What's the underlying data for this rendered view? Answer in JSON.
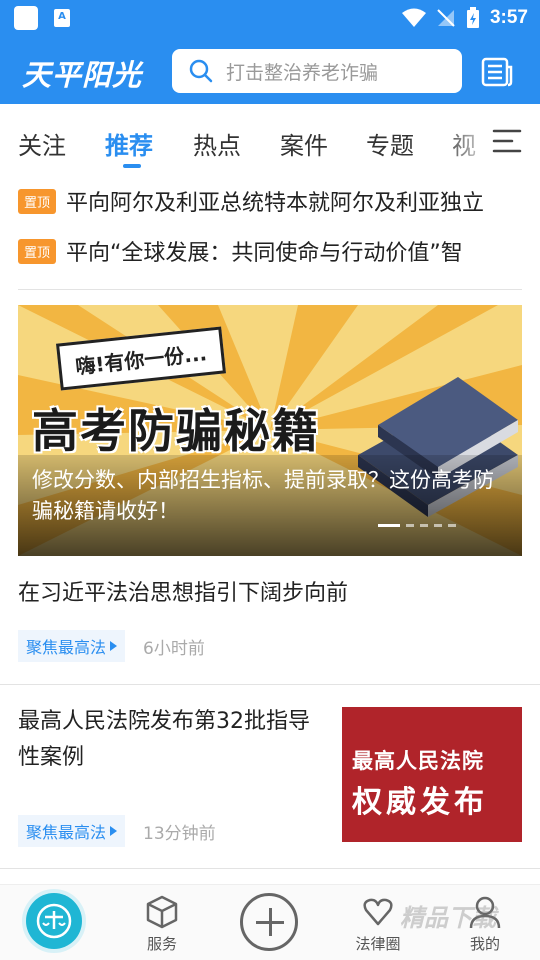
{
  "status_bar": {
    "time": "3:57",
    "app_badge": "A"
  },
  "header": {
    "logo": "天平阳光",
    "search_placeholder": "打击整治养老诈骗"
  },
  "tabs": [
    {
      "label": "关注"
    },
    {
      "label": "推荐"
    },
    {
      "label": "热点"
    },
    {
      "label": "案件"
    },
    {
      "label": "专题"
    },
    {
      "label": "视"
    }
  ],
  "active_tab": "推荐",
  "pinned": [
    {
      "badge": "置顶",
      "text": "平向阿尔及利亚总统特本就阿尔及利亚独立"
    },
    {
      "badge": "置顶",
      "text": "平向“全球发展：共同使命与行动价值”智"
    }
  ],
  "banner": {
    "tag": "嗨!有你一份...",
    "title": "高考防骗秘籍",
    "caption": "修改分数、内部招生指标、提前录取？这份高考防骗秘籍请收好！",
    "slide_count": 5,
    "active_slide": 1
  },
  "articles": [
    {
      "title": "在习近平法治思想指引下阔步向前",
      "source": "聚焦最高法",
      "time": "6小时前"
    },
    {
      "title": "最高人民法院发布第32批指导性案例",
      "source": "聚焦最高法",
      "time": "13分钟前",
      "thumb_line1": "最高人民法院",
      "thumb_line2": "权威发布"
    }
  ],
  "bottom_nav": [
    {
      "label": "",
      "icon": "scales-icon"
    },
    {
      "label": "服务",
      "icon": "cube-icon"
    },
    {
      "label": "",
      "icon": "plus-icon"
    },
    {
      "label": "法律圈",
      "icon": "heart-chat-icon"
    },
    {
      "label": "我的",
      "icon": "person-icon"
    }
  ],
  "watermark": "精品下载",
  "colors": {
    "primary": "#2a8ef0",
    "pin": "#f7962d",
    "thumb": "#b0242a"
  }
}
